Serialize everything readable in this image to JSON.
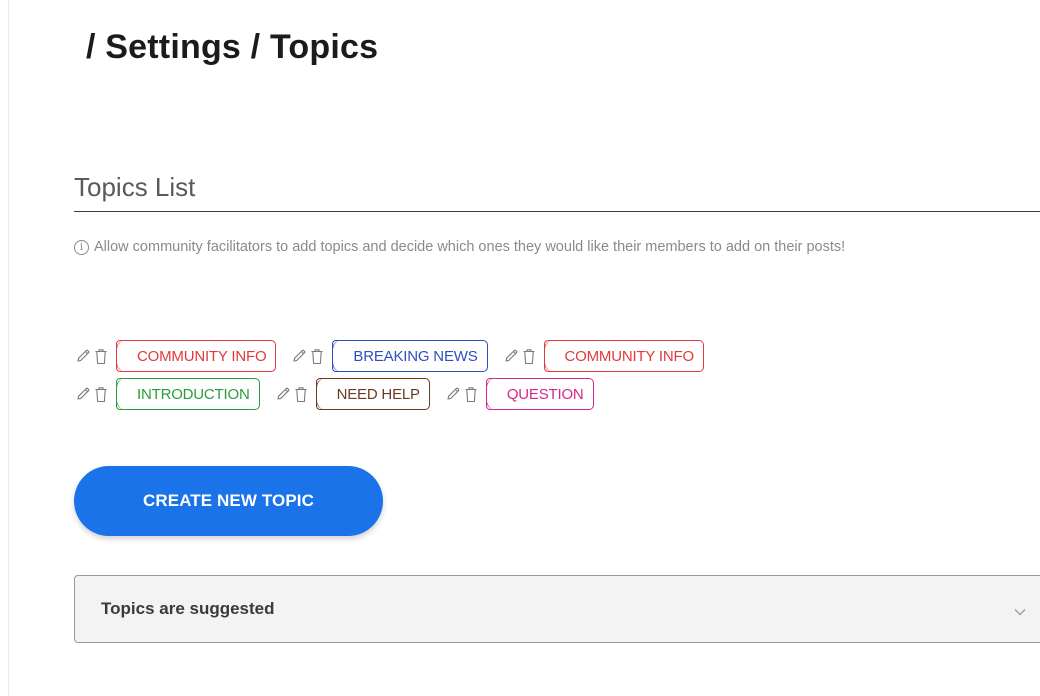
{
  "header": {
    "title": "/ Settings / Topics"
  },
  "topics_section": {
    "title": "Topics List",
    "info_text": "Allow community facilitators to add topics and decide which ones they would like their members to add on their posts!",
    "rows": [
      [
        {
          "label": "COMMUNITY INFO",
          "color": "#e0393e"
        },
        {
          "label": "BREAKING NEWS",
          "color": "#2f4fbf"
        },
        {
          "label": "COMMUNITY INFO",
          "color": "#e0393e"
        }
      ],
      [
        {
          "label": "INTRODUCTION",
          "color": "#2a9d3a"
        },
        {
          "label": "NEED HELP",
          "color": "#6b3a24"
        },
        {
          "label": "QUESTION",
          "color": "#d4288f"
        }
      ]
    ]
  },
  "actions": {
    "create_label": "CREATE NEW TOPIC"
  },
  "suggestion_select": {
    "value": "Topics are suggested"
  },
  "icons": {
    "edit": "pencil-icon",
    "delete": "trash-icon",
    "info": "info-icon",
    "dropdown": "chevron-down-icon"
  },
  "colors": {
    "accent": "#1a73e8"
  }
}
